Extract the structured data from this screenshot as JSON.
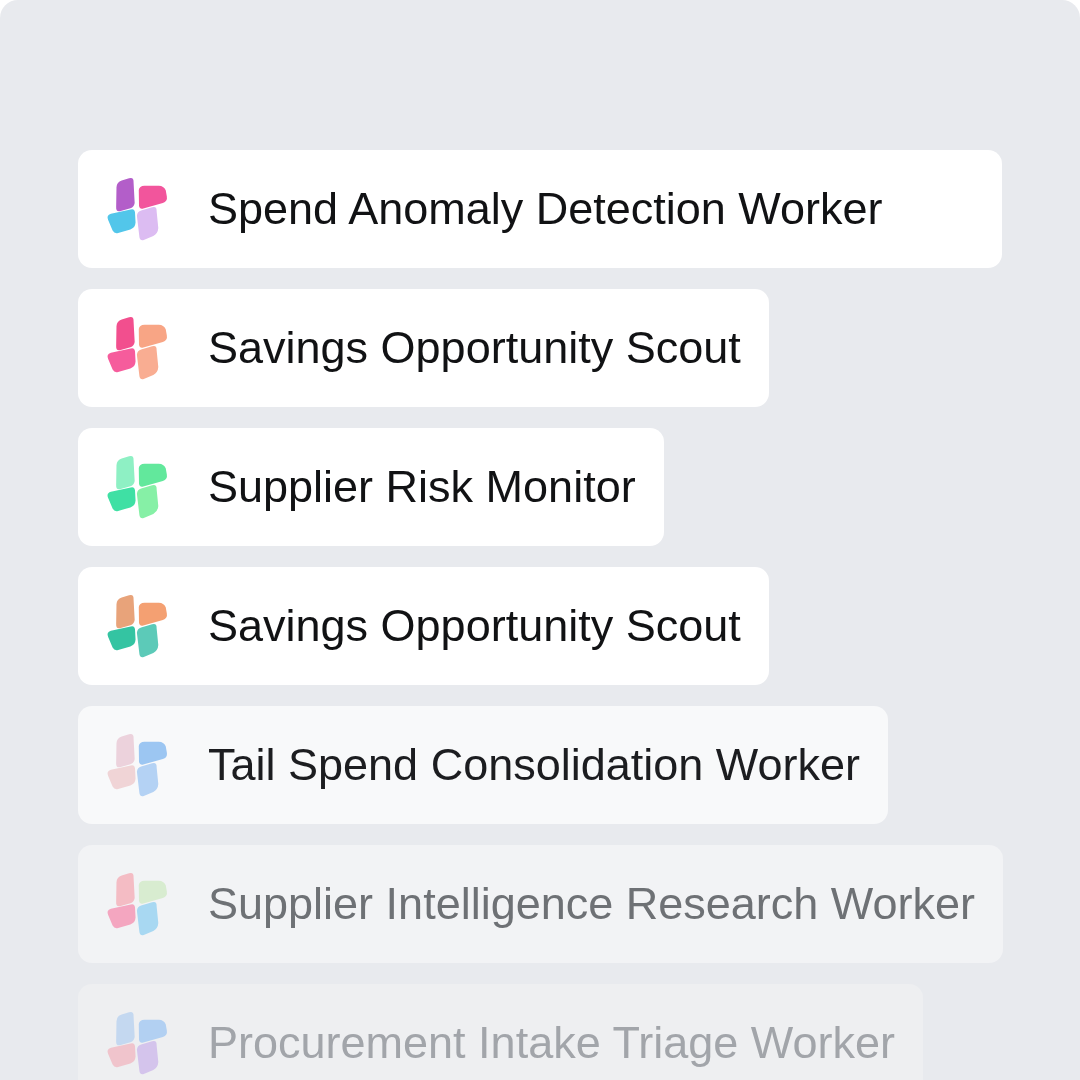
{
  "workers": [
    {
      "name": "Spend Anomaly Detection Worker",
      "petals": [
        {
          "color": "#b35ec9"
        },
        {
          "color": "#f2559c"
        },
        {
          "color": "#dcbcf2"
        },
        {
          "color": "#52c6ea"
        }
      ]
    },
    {
      "name": "Savings Opportunity Scout",
      "petals": [
        {
          "color": "#f24f8e"
        },
        {
          "color": "#f8a585"
        },
        {
          "color": "#f9ad92"
        },
        {
          "color": "#f65c9c"
        }
      ]
    },
    {
      "name": "Supplier Risk Monitor",
      "petals": [
        {
          "color": "#8ef0c4"
        },
        {
          "color": "#62e89c"
        },
        {
          "color": "#86f0a6"
        },
        {
          "color": "#3fe0a4"
        }
      ]
    },
    {
      "name": "Savings Opportunity Scout",
      "petals": [
        {
          "color": "#e8a37a"
        },
        {
          "color": "#f4a072"
        },
        {
          "color": "#5ccab8"
        },
        {
          "color": "#34c4a2"
        }
      ]
    },
    {
      "name": "Tail Spend Consolidation Worker",
      "petals": [
        {
          "color": "#ecd2dc"
        },
        {
          "color": "#9cc6f2"
        },
        {
          "color": "#b4d2f4"
        },
        {
          "color": "#f0d4d6"
        }
      ]
    },
    {
      "name": "Supplier Intelligence Research Worker",
      "petals": [
        {
          "color": "#f4bcc4"
        },
        {
          "color": "#d8ecd0"
        },
        {
          "color": "#a8d8f2"
        },
        {
          "color": "#f4a6c0"
        }
      ]
    },
    {
      "name": "Procurement Intake Triage Worker",
      "petals": [
        {
          "color": "#c4d8f0"
        },
        {
          "color": "#b2d0f2"
        },
        {
          "color": "#d4c4ec"
        },
        {
          "color": "#f0c4cc"
        }
      ]
    }
  ]
}
